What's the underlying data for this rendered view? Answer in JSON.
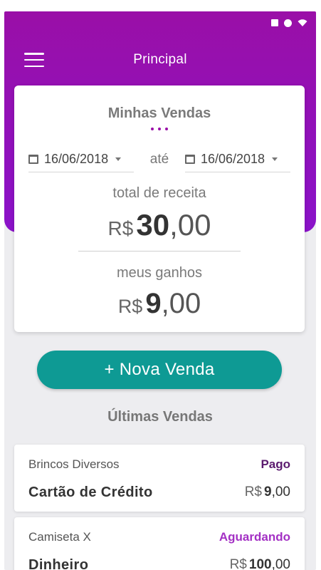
{
  "app": {
    "title": "Principal"
  },
  "summary": {
    "title": "Minhas Vendas",
    "date_from": "16/06/2018",
    "separator": "até",
    "date_to": "16/06/2018",
    "revenue_label": "total de receita",
    "revenue_currency": "R$",
    "revenue_int": "30",
    "revenue_dec": ",00",
    "earnings_label": "meus ganhos",
    "earnings_currency": "R$",
    "earnings_int": "9",
    "earnings_dec": ",00"
  },
  "actions": {
    "new_sale": "+ Nova Venda"
  },
  "recent": {
    "title": "Últimas Vendas",
    "items": [
      {
        "name": "Brincos Diversos",
        "status": "Pago",
        "status_color": "#5b1a6e",
        "method": "Cartão de Crédito",
        "currency": "R$",
        "value_int": "9",
        "value_dec": ",00"
      },
      {
        "name": "Camiseta X",
        "status": "Aguardando",
        "status_color": "#a330c4",
        "method": "Dinheiro",
        "currency": "R$",
        "value_int": "100",
        "value_dec": ",00"
      }
    ]
  },
  "colors": {
    "header": "#9a0fa7",
    "accent_button": "#0e9a94"
  }
}
